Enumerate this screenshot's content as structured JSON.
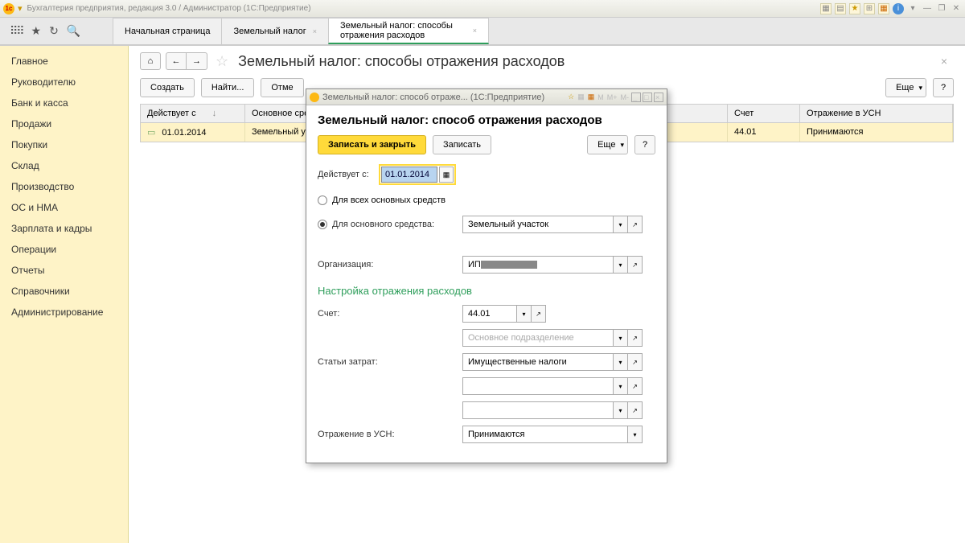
{
  "window": {
    "title": "Бухгалтерия предприятия, редакция 3.0 / Администратор  (1С:Предприятие)"
  },
  "tabs": [
    {
      "label": "Начальная страница"
    },
    {
      "label": "Земельный налог"
    },
    {
      "label": "Земельный налог: способы отражения расходов"
    }
  ],
  "sidebar": {
    "items": [
      "Главное",
      "Руководителю",
      "Банк и касса",
      "Продажи",
      "Покупки",
      "Склад",
      "Производство",
      "ОС и НМА",
      "Зарплата и кадры",
      "Операции",
      "Отчеты",
      "Справочники",
      "Администрирование"
    ]
  },
  "page": {
    "title": "Земельный налог: способы отражения расходов",
    "buttons": {
      "create": "Создать",
      "find": "Найти...",
      "cancel": "Отме",
      "more": "Еще"
    },
    "grid": {
      "headers": {
        "date": "Действует с",
        "os": "Основное сре",
        "acc": "Счет",
        "usn": "Отражение в УСН"
      },
      "row": {
        "date": "01.01.2014",
        "os": "Земельный уч",
        "acc": "44.01",
        "usn": "Принимаются"
      }
    }
  },
  "dialog": {
    "wintitle": "Земельный налог: способ отраже...  (1С:Предприятие)",
    "title": "Земельный налог: способ отражения расходов",
    "buttons": {
      "save_close": "Записать и закрыть",
      "save": "Записать",
      "more": "Еще"
    },
    "labels": {
      "valid_from": "Действует с:",
      "for_all": "Для всех основных средств",
      "for_one": "Для основного средства:",
      "org": "Организация:",
      "section": "Настройка отражения расходов",
      "account": "Счет:",
      "cost_item": "Статьи затрат:",
      "usn": "Отражение в УСН:"
    },
    "values": {
      "date": "01.01.2014",
      "asset": "Земельный участок",
      "org_prefix": "ИП",
      "account": "44.01",
      "subdiv_placeholder": "Основное подразделение",
      "cost_item": "Имущественные налоги",
      "usn": "Принимаются"
    }
  }
}
